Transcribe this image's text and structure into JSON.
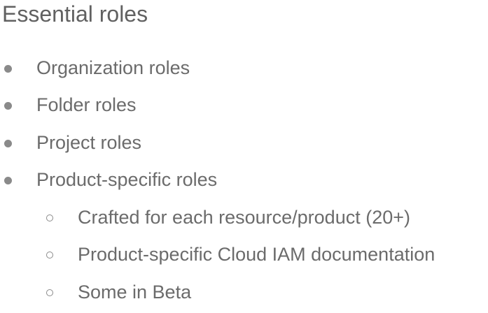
{
  "title": "Essential roles",
  "bullets": [
    {
      "text": "Organization roles",
      "level": 1
    },
    {
      "text": "Folder roles",
      "level": 1
    },
    {
      "text": "Project roles",
      "level": 1
    },
    {
      "text": "Product-specific roles",
      "level": 1
    },
    {
      "text": "Crafted for each resource/product (20+)",
      "level": 2
    },
    {
      "text": "Product-specific Cloud IAM documentation",
      "level": 2
    },
    {
      "text": "Some in Beta",
      "level": 2
    }
  ]
}
